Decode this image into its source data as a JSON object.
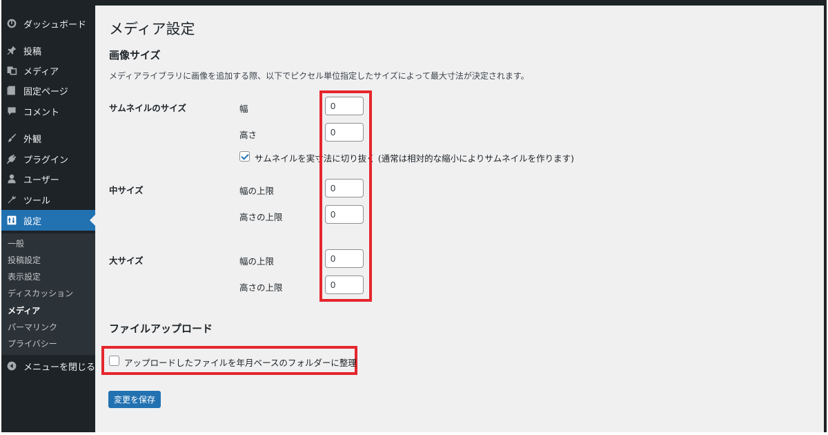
{
  "sidebar": {
    "items": [
      {
        "label": "ダッシュボード",
        "icon": "dashboard-icon"
      },
      {
        "label": "投稿",
        "icon": "pin-icon"
      },
      {
        "label": "メディア",
        "icon": "media-icon"
      },
      {
        "label": "固定ページ",
        "icon": "page-icon"
      },
      {
        "label": "コメント",
        "icon": "comment-icon"
      },
      {
        "label": "外観",
        "icon": "brush-icon"
      },
      {
        "label": "プラグイン",
        "icon": "plugin-icon"
      },
      {
        "label": "ユーザー",
        "icon": "user-icon"
      },
      {
        "label": "ツール",
        "icon": "wrench-icon"
      },
      {
        "label": "設定",
        "icon": "settings-icon"
      }
    ],
    "submenu": [
      {
        "label": "一般"
      },
      {
        "label": "投稿設定"
      },
      {
        "label": "表示設定"
      },
      {
        "label": "ディスカッション"
      },
      {
        "label": "メディア"
      },
      {
        "label": "パーマリンク"
      },
      {
        "label": "プライバシー"
      }
    ],
    "collapse_label": "メニューを閉じる"
  },
  "page": {
    "title": "メディア設定",
    "image_sizes": {
      "heading": "画像サイズ",
      "description": "メディアライブラリに画像を追加する際、以下でピクセル単位指定したサイズによって最大寸法が決定されます。",
      "thumbnail": {
        "label": "サムネイルのサイズ",
        "width_label": "幅",
        "width_value": "0",
        "height_label": "高さ",
        "height_value": "0",
        "crop_label": "サムネイルを実寸法に切り抜く (通常は相対的な縮小によりサムネイルを作ります)",
        "crop_checked": true
      },
      "medium": {
        "label": "中サイズ",
        "width_label": "幅の上限",
        "width_value": "0",
        "height_label": "高さの上限",
        "height_value": "0"
      },
      "large": {
        "label": "大サイズ",
        "width_label": "幅の上限",
        "width_value": "0",
        "height_label": "高さの上限",
        "height_value": "0"
      }
    },
    "uploads": {
      "heading": "ファイルアップロード",
      "organize_label": "アップロードしたファイルを年月ベースのフォルダーに整理",
      "organize_checked": false
    },
    "save_label": "変更を保存"
  },
  "colors": {
    "sidebar_bg": "#1d2327",
    "active_bg": "#2271b1",
    "highlight": "#e5262c",
    "content_bg": "#f0f0f1"
  }
}
